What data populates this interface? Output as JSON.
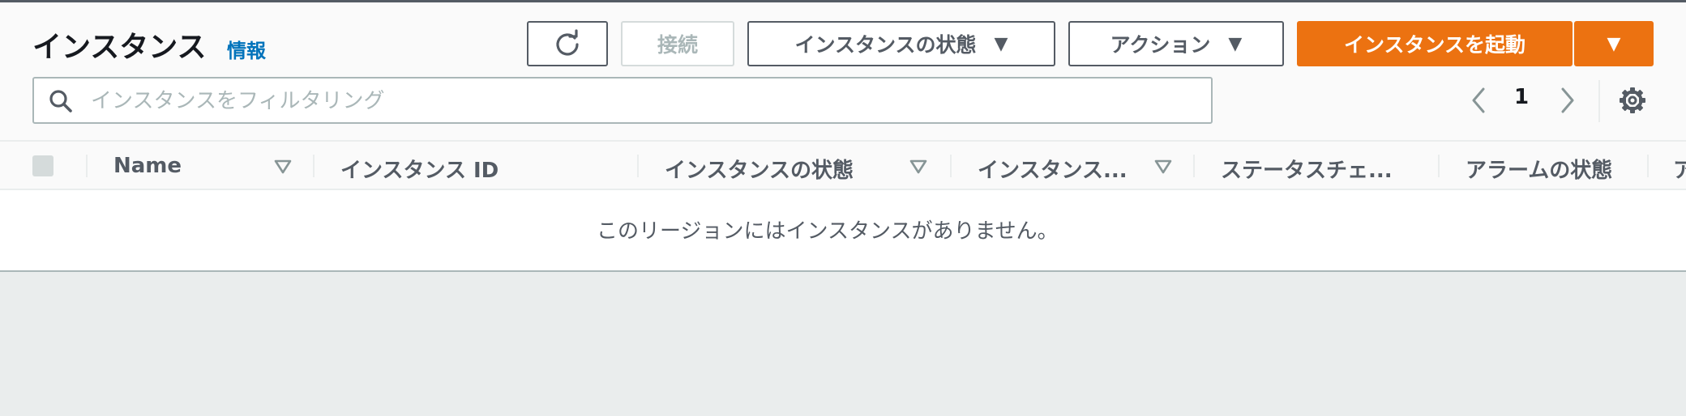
{
  "header": {
    "title": "インスタンス",
    "info_link": "情報"
  },
  "toolbar": {
    "refresh_icon": "refresh-icon",
    "connect_label": "接続",
    "instance_state_label": "インスタンスの状態",
    "actions_label": "アクション",
    "launch_label": "インスタンスを起動",
    "dropdown_icon": "▼"
  },
  "search": {
    "placeholder": "インスタンスをフィルタリング"
  },
  "pagination": {
    "current_page": "1"
  },
  "table": {
    "columns": [
      "Name",
      "インスタンス ID",
      "インスタンスの状態",
      "インスタンス...",
      "ステータスチェ...",
      "アラームの状態",
      "ア"
    ],
    "empty_message": "このリージョンにはインスタンスがありません。"
  },
  "colors": {
    "accent": "#ec7211",
    "link": "#0073bb",
    "text": "#16191f",
    "muted": "#545b64",
    "background": "#eaeded"
  }
}
